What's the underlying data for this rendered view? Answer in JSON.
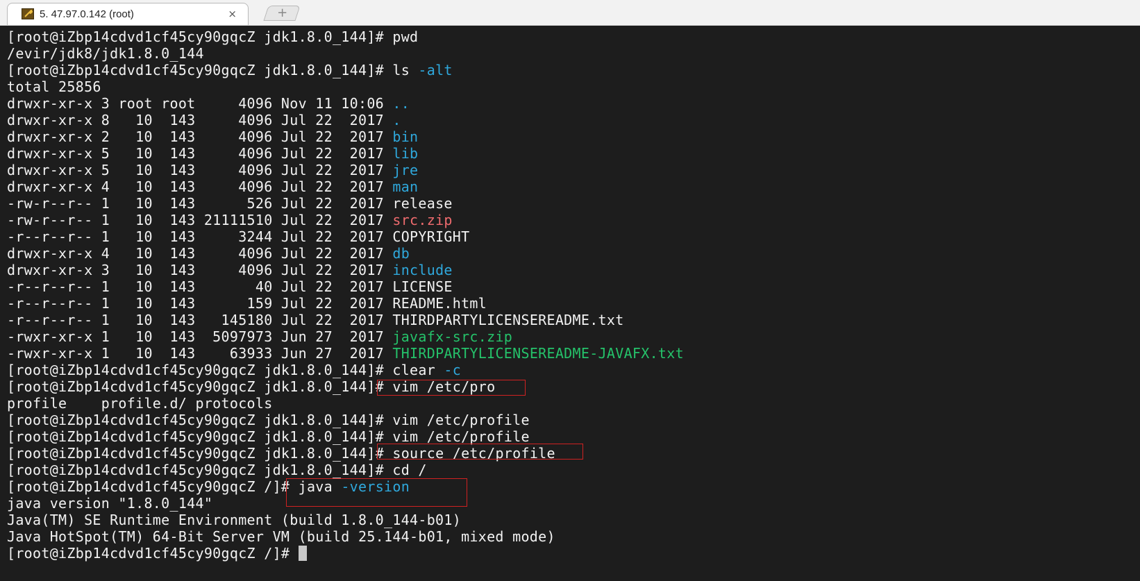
{
  "window": {
    "tab_title": "5. 47.97.0.142 (root)",
    "close_glyph": "×",
    "new_tab_glyph": "+"
  },
  "colors": {
    "background": "#1d1d1d",
    "text": "#f2f2f2",
    "directory": "#2fa8dc",
    "archive": "#ee6b6e",
    "executable": "#25c26a",
    "highlight_box": "#d12222"
  },
  "terminal": {
    "prompt_jdk": "[root@iZbp14cdvd1cf45cy90gqcZ jdk1.8.0_144]#",
    "prompt_root": "[root@iZbp14cdvd1cf45cy90gqcZ /]#",
    "pwd_cmd": "pwd",
    "pwd_output": "/evir/jdk8/jdk1.8.0_144",
    "ls_cmd": "ls",
    "ls_flag": "-alt",
    "total": "total 25856",
    "entries": [
      {
        "meta": "drwxr-xr-x 3 root root     4096 Nov 11 10:06",
        "name": ".."
      },
      {
        "meta": "drwxr-xr-x 8   10  143     4096 Jul 22  2017",
        "name": "."
      },
      {
        "meta": "drwxr-xr-x 2   10  143     4096 Jul 22  2017",
        "name": "bin"
      },
      {
        "meta": "drwxr-xr-x 5   10  143     4096 Jul 22  2017",
        "name": "lib"
      },
      {
        "meta": "drwxr-xr-x 5   10  143     4096 Jul 22  2017",
        "name": "jre"
      },
      {
        "meta": "drwxr-xr-x 4   10  143     4096 Jul 22  2017",
        "name": "man"
      },
      {
        "meta": "-rw-r--r-- 1   10  143      526 Jul 22  2017",
        "name": "release"
      },
      {
        "meta": "-rw-r--r-- 1   10  143 21111510 Jul 22  2017",
        "name": "src.zip"
      },
      {
        "meta": "-r--r--r-- 1   10  143     3244 Jul 22  2017",
        "name": "COPYRIGHT"
      },
      {
        "meta": "drwxr-xr-x 4   10  143     4096 Jul 22  2017",
        "name": "db"
      },
      {
        "meta": "drwxr-xr-x 3   10  143     4096 Jul 22  2017",
        "name": "include"
      },
      {
        "meta": "-r--r--r-- 1   10  143       40 Jul 22  2017",
        "name": "LICENSE"
      },
      {
        "meta": "-r--r--r-- 1   10  143      159 Jul 22  2017",
        "name": "README.html"
      },
      {
        "meta": "-r--r--r-- 1   10  143   145180 Jul 22  2017",
        "name": "THIRDPARTYLICENSEREADME.txt"
      },
      {
        "meta": "-rwxr-xr-x 1   10  143  5097973 Jun 27  2017",
        "name": "javafx-src.zip"
      },
      {
        "meta": "-rwxr-xr-x 1   10  143    63933 Jun 27  2017",
        "name": "THIRDPARTYLICENSEREADME-JAVAFX.txt"
      }
    ],
    "clear_cmd": "clear",
    "clear_flag": "-c",
    "vim_partial_cmd": "vim /etc/pro",
    "completion": "profile    profile.d/ protocols",
    "vim_profile_cmd": "vim /etc/profile",
    "source_cmd": "source /etc/profile",
    "cd_cmd": "cd /",
    "java_cmd": "java",
    "java_flag": "-version",
    "java_version_out": "java version \"1.8.0_144\"",
    "runtime_out": "Java(TM) SE Runtime Environment (build 1.8.0_144-b01)",
    "hotspot_out": "Java HotSpot(TM) 64-Bit Server VM (build 25.144-b01, mixed mode)"
  }
}
